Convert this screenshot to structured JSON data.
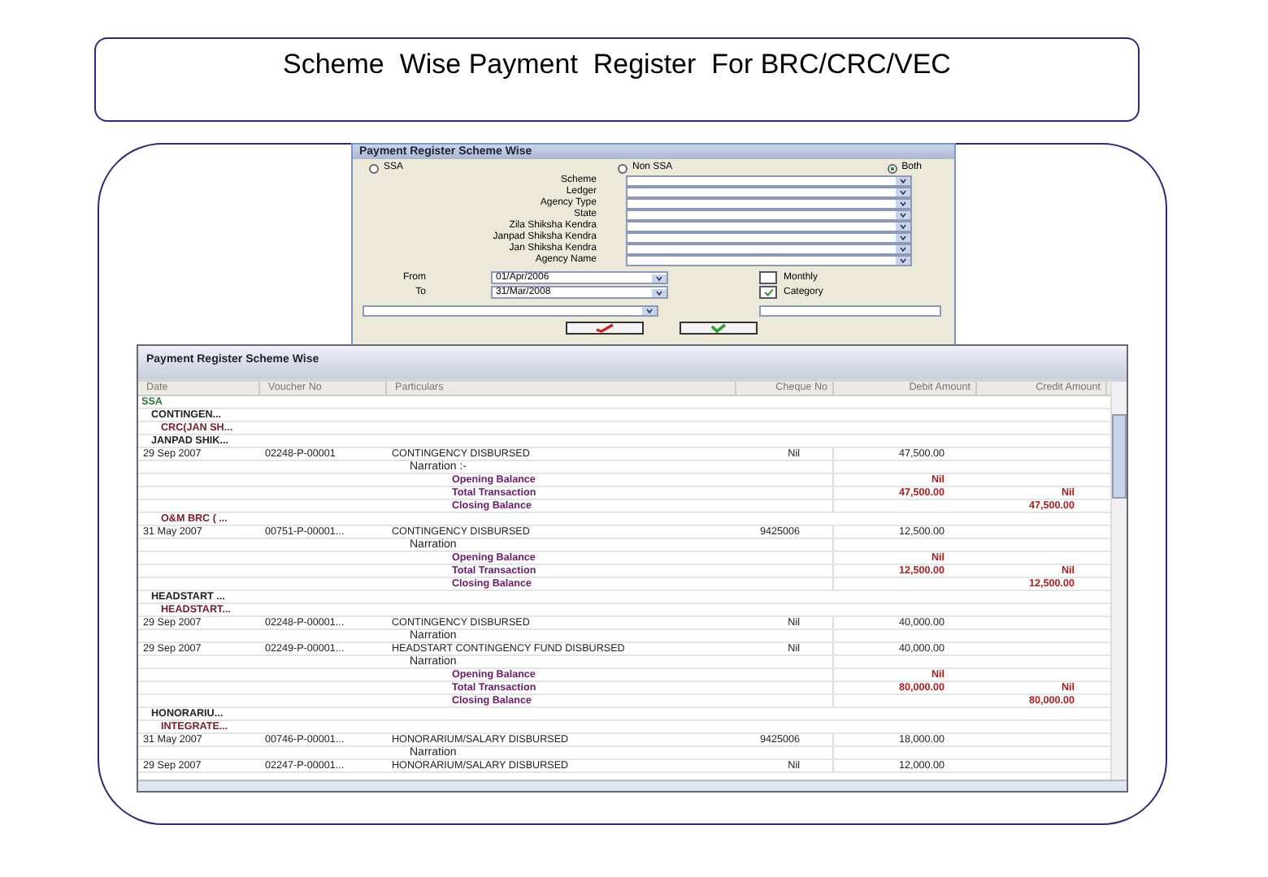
{
  "slide_title": "Scheme  Wise Payment  Register  For BRC/CRC/VEC",
  "dialog": {
    "title": "Payment Register Scheme Wise",
    "radios": [
      {
        "label": "SSA",
        "selected": false
      },
      {
        "label": "Non SSA",
        "selected": false
      },
      {
        "label": "Both",
        "selected": true
      }
    ],
    "fields": [
      {
        "label": "Scheme"
      },
      {
        "label": "Ledger"
      },
      {
        "label": "Agency Type"
      },
      {
        "label": "State"
      },
      {
        "label": "Zila Shiksha Kendra"
      },
      {
        "label": "Janpad Shiksha Kendra"
      },
      {
        "label": "Jan Shiksha Kendra"
      },
      {
        "label": "Agency Name"
      }
    ],
    "dates": [
      {
        "label": "From",
        "value": "01/Apr/2006"
      },
      {
        "label": "To",
        "value": "31/Mar/2008"
      }
    ],
    "checkboxes": [
      {
        "label": "Monthly",
        "checked": false
      },
      {
        "label": "Category",
        "checked": true
      }
    ]
  },
  "report": {
    "title": "Payment Register Scheme Wise",
    "columns": [
      "Date",
      "Voucher No",
      "Particulars",
      "Cheque No",
      "Debit Amount",
      "Credit Amount"
    ],
    "rows": [
      {
        "kind": "scheme",
        "text": "SSA"
      },
      {
        "kind": "head",
        "text": "CONTINGEN..."
      },
      {
        "kind": "agency",
        "text": "CRC(JAN SH..."
      },
      {
        "kind": "head",
        "text": "JANPAD SHIK..."
      },
      {
        "kind": "entry",
        "date": "29 Sep 2007",
        "voucher": "02248-P-00001",
        "particulars": "CONTINGENCY DISBURSED",
        "cheque": "Nil",
        "debit": "47,500.00"
      },
      {
        "kind": "narration",
        "text": "Narration :-"
      },
      {
        "kind": "balance",
        "text": "Opening Balance",
        "debit": "Nil"
      },
      {
        "kind": "balance",
        "text": "Total Transaction",
        "debit": "47,500.00",
        "credit": "Nil"
      },
      {
        "kind": "balance",
        "text": "Closing Balance",
        "credit": "47,500.00"
      },
      {
        "kind": "agency",
        "text": "O&M BRC ( ..."
      },
      {
        "kind": "entry",
        "date": "31 May 2007",
        "voucher": "00751-P-00001...",
        "particulars": "CONTINGENCY DISBURSED",
        "cheque": "9425006",
        "debit": "12,500.00"
      },
      {
        "kind": "narration",
        "text": "Narration"
      },
      {
        "kind": "balance",
        "text": "Opening Balance",
        "debit": "Nil"
      },
      {
        "kind": "balance",
        "text": "Total Transaction",
        "debit": "12,500.00",
        "credit": "Nil"
      },
      {
        "kind": "balance",
        "text": "Closing Balance",
        "credit": "12,500.00"
      },
      {
        "kind": "head",
        "text": "HEADSTART ..."
      },
      {
        "kind": "agency",
        "text": "HEADSTART..."
      },
      {
        "kind": "entry",
        "date": "29 Sep 2007",
        "voucher": "02248-P-00001...",
        "particulars": "CONTINGENCY DISBURSED",
        "cheque": "Nil",
        "debit": "40,000.00"
      },
      {
        "kind": "narration",
        "text": "Narration"
      },
      {
        "kind": "entry",
        "date": "29 Sep 2007",
        "voucher": "02249-P-00001...",
        "particulars": "HEADSTART CONTINGENCY FUND DISBURSED",
        "cheque": "Nil",
        "debit": "40,000.00"
      },
      {
        "kind": "narration",
        "text": "Narration"
      },
      {
        "kind": "balance",
        "text": "Opening Balance",
        "debit": "Nil"
      },
      {
        "kind": "balance",
        "text": "Total Transaction",
        "debit": "80,000.00",
        "credit": "Nil"
      },
      {
        "kind": "balance",
        "text": "Closing Balance",
        "credit": "80,000.00"
      },
      {
        "kind": "head",
        "text": "HONORARIU..."
      },
      {
        "kind": "agency",
        "text": "INTEGRATE..."
      },
      {
        "kind": "entry",
        "date": "31 May 2007",
        "voucher": "00746-P-00001...",
        "particulars": "HONORARIUM/SALARY DISBURSED",
        "cheque": "9425006",
        "debit": "18,000.00"
      },
      {
        "kind": "narration",
        "text": "Narration"
      },
      {
        "kind": "entry",
        "date": "29 Sep 2007",
        "voucher": "02247-P-00001...",
        "particulars": "HONORARIUM/SALARY DISBURSED",
        "cheque": "Nil",
        "debit": "12,000.00"
      }
    ]
  }
}
